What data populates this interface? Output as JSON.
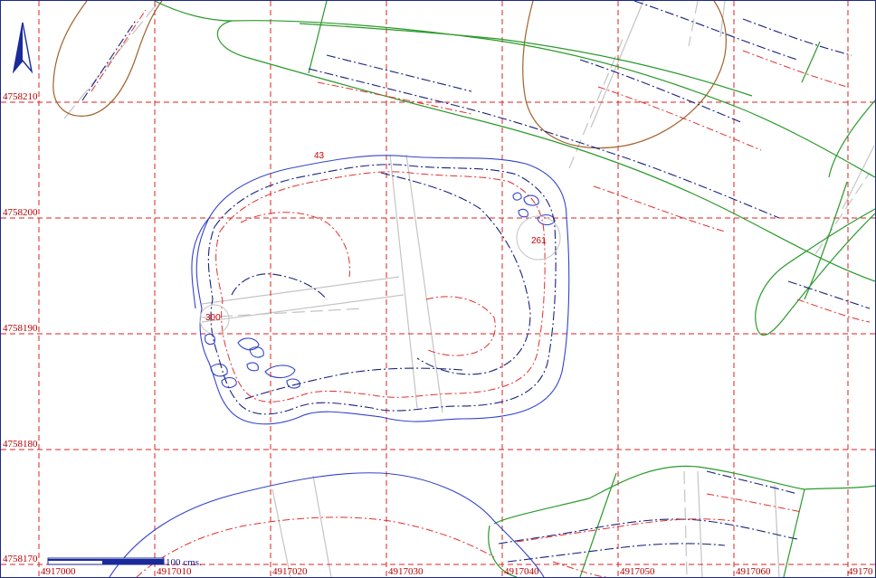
{
  "map": {
    "north_arrow": "north-arrow-icon",
    "grid_labels": {
      "y": [
        "4758210",
        "4758200",
        "4758190",
        "4758180",
        "4758170"
      ],
      "x": [
        "4917000",
        "4917010",
        "4917020",
        "4917030",
        "4917040",
        "4917050",
        "4917060",
        "49170"
      ]
    },
    "contour_labels": [
      "43",
      "261",
      "300"
    ],
    "scale_bar": {
      "label": "100 cms."
    },
    "colors": {
      "grid": "#dd2222",
      "water_outline": "#3344cc",
      "contour_blue": "#1a237e",
      "contour_red": "#e03030",
      "vegetation": "#2a9a2a",
      "terrain": "#a0622a",
      "road": "#c4c4c4"
    }
  }
}
